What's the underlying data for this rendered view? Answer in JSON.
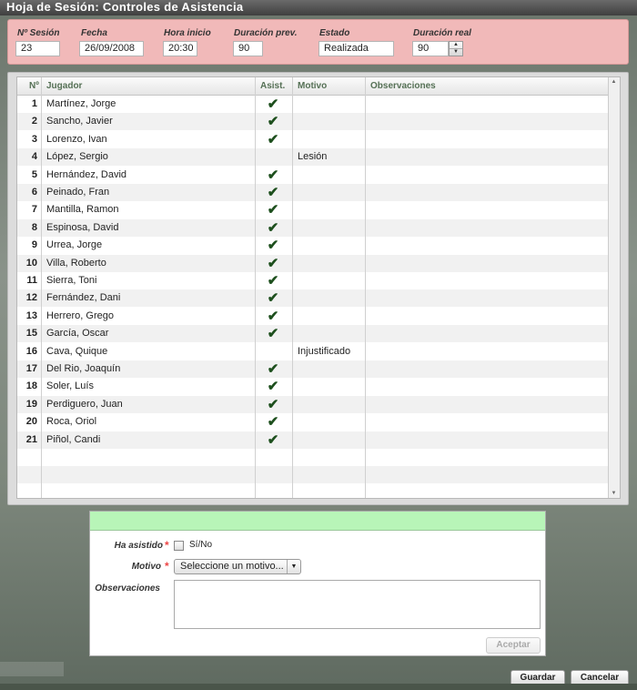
{
  "window": {
    "title": "Hoja de Sesión: Controles de Asistencia"
  },
  "header": {
    "sesion": {
      "label": "Nº Sesión",
      "value": "23"
    },
    "fecha": {
      "label": "Fecha",
      "value": "26/09/2008"
    },
    "hora": {
      "label": "Hora inicio",
      "value": "20:30"
    },
    "duracion_prev": {
      "label": "Duración prev.",
      "value": "90"
    },
    "estado": {
      "label": "Estado",
      "value": "Realizada"
    },
    "duracion_real": {
      "label": "Duración real",
      "value": "90"
    }
  },
  "grid": {
    "columns": [
      "Nº",
      "Jugador",
      "Asist.",
      "Motivo",
      "Observaciones"
    ],
    "rows": [
      {
        "num": "1",
        "jugador": "Martínez, Jorge",
        "asist": "✔",
        "motivo": ""
      },
      {
        "num": "2",
        "jugador": "Sancho, Javier",
        "asist": "✔",
        "motivo": ""
      },
      {
        "num": "3",
        "jugador": "Lorenzo, Ivan",
        "asist": "✔",
        "motivo": ""
      },
      {
        "num": "4",
        "jugador": "López, Sergio",
        "asist": "",
        "motivo": "Lesión"
      },
      {
        "num": "5",
        "jugador": "Hernández, David",
        "asist": "✔",
        "motivo": ""
      },
      {
        "num": "6",
        "jugador": "Peinado, Fran",
        "asist": "✔",
        "motivo": ""
      },
      {
        "num": "7",
        "jugador": "Mantilla, Ramon",
        "asist": "✔",
        "motivo": ""
      },
      {
        "num": "8",
        "jugador": "Espinosa, David",
        "asist": "✔",
        "motivo": ""
      },
      {
        "num": "9",
        "jugador": "Urrea, Jorge",
        "asist": "✔",
        "motivo": ""
      },
      {
        "num": "10",
        "jugador": "Villa, Roberto",
        "asist": "✔",
        "motivo": ""
      },
      {
        "num": "11",
        "jugador": "Sierra, Toni",
        "asist": "✔",
        "motivo": ""
      },
      {
        "num": "12",
        "jugador": "Fernández, Dani",
        "asist": "✔",
        "motivo": ""
      },
      {
        "num": "13",
        "jugador": "Herrero, Grego",
        "asist": "✔",
        "motivo": ""
      },
      {
        "num": "15",
        "jugador": "García, Oscar",
        "asist": "✔",
        "motivo": ""
      },
      {
        "num": "16",
        "jugador": "Cava, Quique",
        "asist": "",
        "motivo": "Injustificado"
      },
      {
        "num": "17",
        "jugador": "Del Rio, Joaquín",
        "asist": "✔",
        "motivo": ""
      },
      {
        "num": "18",
        "jugador": "Soler, Luís",
        "asist": "✔",
        "motivo": ""
      },
      {
        "num": "19",
        "jugador": "Perdiguero, Juan",
        "asist": "✔",
        "motivo": ""
      },
      {
        "num": "20",
        "jugador": "Roca, Oriol",
        "asist": "✔",
        "motivo": ""
      },
      {
        "num": "21",
        "jugador": "Piñol, Candi",
        "asist": "✔",
        "motivo": ""
      }
    ]
  },
  "form": {
    "asistido_label": "Ha asistido",
    "asistido_text": "Sí/No",
    "motivo_label": "Motivo",
    "motivo_value": "Seleccione un motivo...",
    "observaciones_label": "Observaciones",
    "aceptar": "Aceptar"
  },
  "footer": {
    "guardar": "Guardar",
    "cancelar": "Cancelar"
  },
  "colors": {
    "header_bg": "#f1b9b9",
    "form_band": "#b8f5b8",
    "check": "#1d4f1d"
  }
}
